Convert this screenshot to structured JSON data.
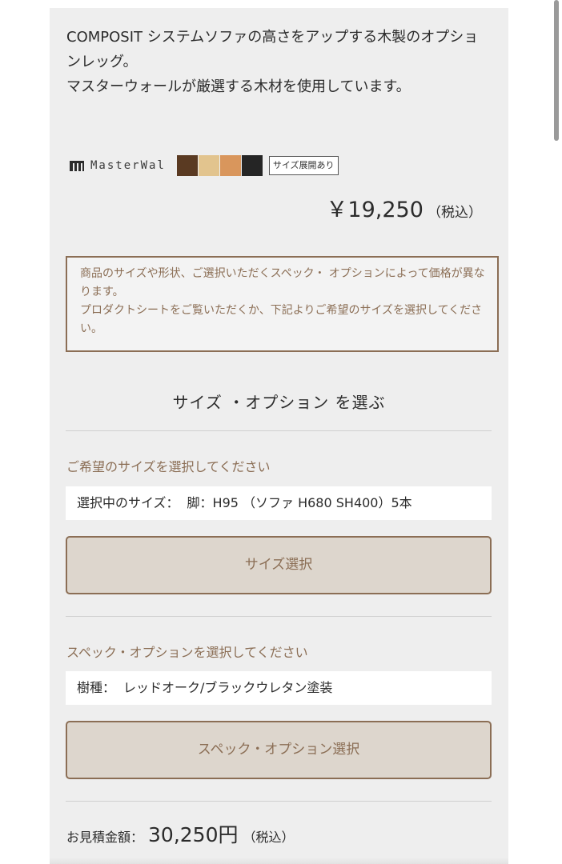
{
  "description": {
    "line1": "COMPOSIT システムソファの高さをアップする木製のオプションレッグ。",
    "line2": "マスターウォールが厳選する木材を使用しています。"
  },
  "brand": {
    "name": "MasterWal",
    "swatches": [
      "#5a3a22",
      "#e2c48e",
      "#d9965c",
      "#252525"
    ],
    "size_badge": "サイズ展開あり"
  },
  "price": {
    "amount": "￥19,250",
    "tax": "（税込）"
  },
  "notice": {
    "line1": "商品のサイズや形状、ご選択いただくスペック・ オプションによって価格が異なります。",
    "line2": "プロダクトシートをご覧いただくか、下記よりご希望のサイズを選択してください。"
  },
  "section_title": "サイズ ・オプション を選ぶ",
  "size": {
    "heading": "ご希望のサイズを選択してください",
    "selected_label": "選択中のサイズ：",
    "selected_value": "脚：H95 （ソファ H680 SH400）5本",
    "button": "サイズ選択"
  },
  "spec": {
    "heading": "スペック・オプションを選択してください",
    "selected_label": "樹種：",
    "selected_value": "レッドオーク/ブラックウレタン塗装",
    "button": "スペック・オプション選択"
  },
  "estimate": {
    "label": "お見積金額：",
    "amount": "30,250円",
    "tax": "（税込）"
  }
}
